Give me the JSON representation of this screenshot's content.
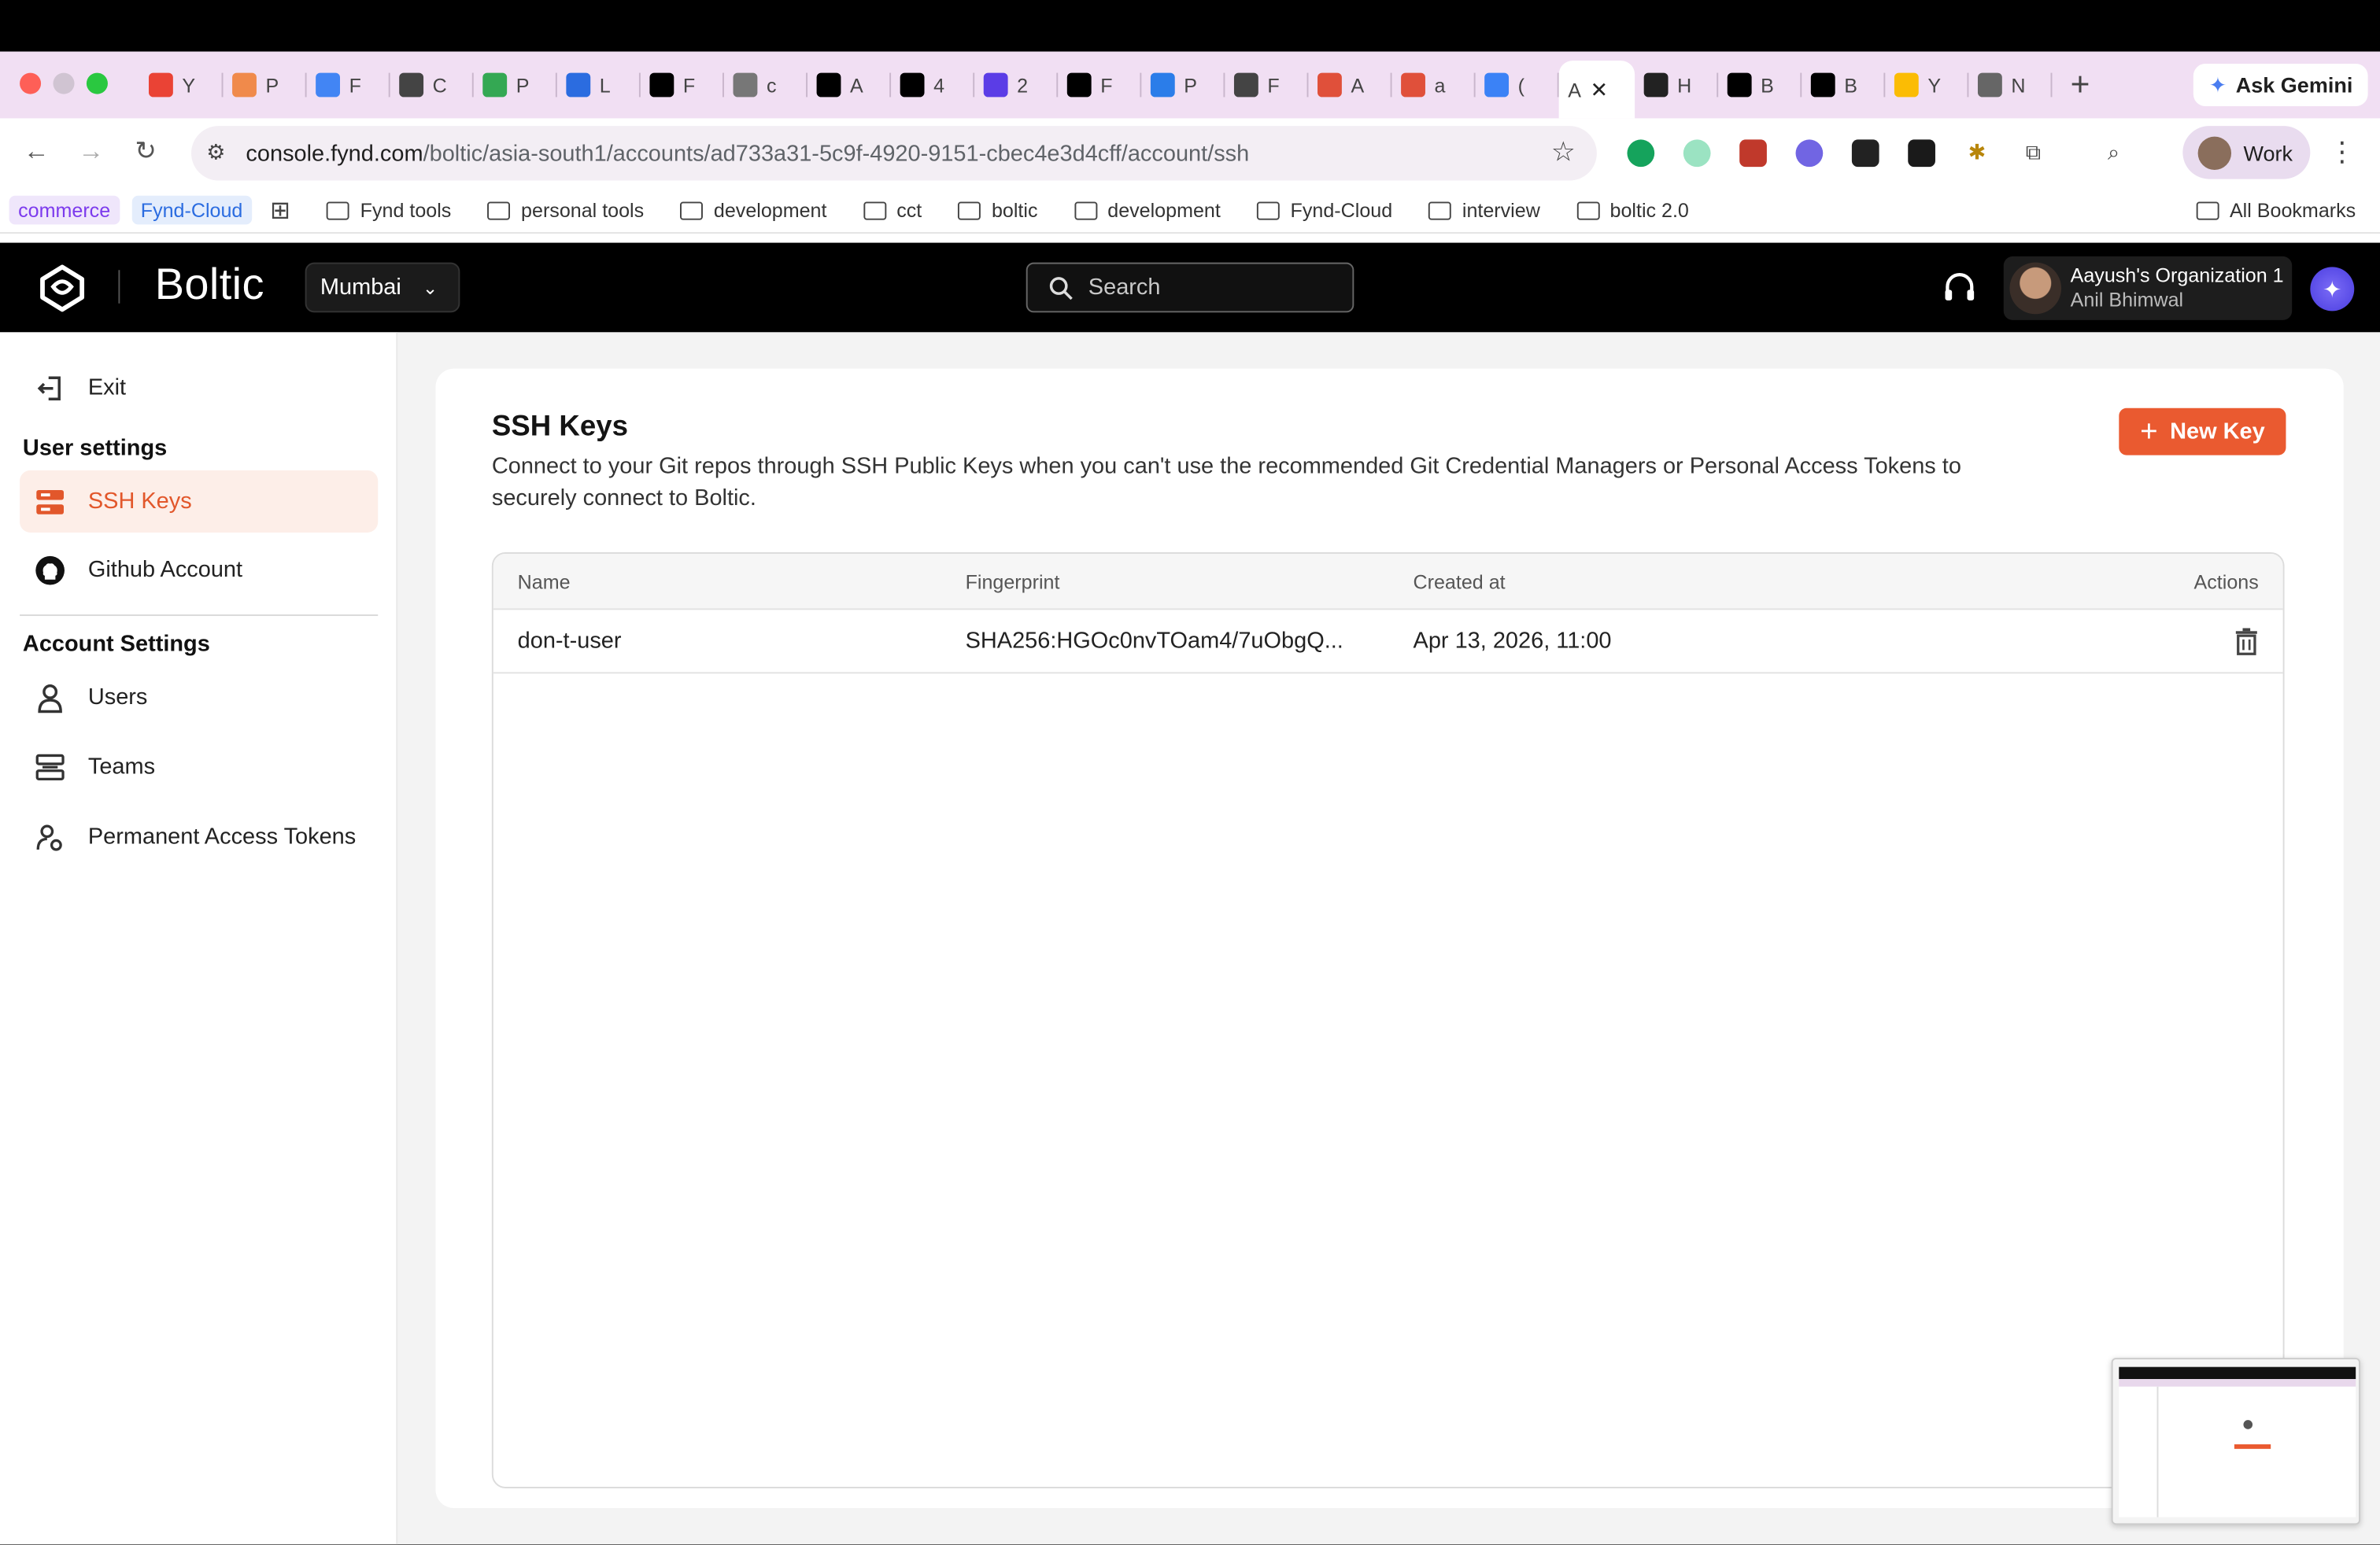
{
  "browser": {
    "tabs": [
      {
        "icon": "gmail-icon",
        "letter": "Y",
        "color": "#ea4335"
      },
      {
        "icon": "orange-circle-icon",
        "letter": "P",
        "color": "#f08a4b"
      },
      {
        "icon": "calendar-icon",
        "letter": "F",
        "color": "#4285f4"
      },
      {
        "icon": "openai-icon",
        "letter": "C",
        "color": "#444444"
      },
      {
        "icon": "sheets-icon",
        "letter": "P",
        "color": "#34a853"
      },
      {
        "icon": "triangle-icon",
        "letter": "L",
        "color": "#2b6ce0"
      },
      {
        "icon": "boltic-icon",
        "letter": "F",
        "color": "#000000"
      },
      {
        "icon": "globe-icon",
        "letter": "c",
        "color": "#777777"
      },
      {
        "icon": "boltic-icon",
        "letter": "A",
        "color": "#000000"
      },
      {
        "icon": "boltic-icon",
        "letter": "4",
        "color": "#000000"
      },
      {
        "icon": "purple-square-icon",
        "letter": "2",
        "color": "#5b3de6"
      },
      {
        "icon": "boltic-icon",
        "letter": "F",
        "color": "#000000"
      },
      {
        "icon": "azure-icon",
        "letter": "P",
        "color": "#2b7de9"
      },
      {
        "icon": "boltic-outline-icon",
        "letter": "F",
        "color": "#444444"
      },
      {
        "icon": "red-bolt-icon",
        "letter": "A",
        "color": "#e0503a"
      },
      {
        "icon": "red-bolt-icon",
        "letter": "a",
        "color": "#e0503a"
      },
      {
        "icon": "blue-doc-icon",
        "letter": "(",
        "color": "#3b82f6"
      },
      {
        "icon": "active-tab",
        "letter": "A",
        "color": "#ffffff"
      },
      {
        "icon": "openai-icon",
        "letter": "H",
        "color": "#222222"
      },
      {
        "icon": "boltic-icon",
        "letter": "B",
        "color": "#000000"
      },
      {
        "icon": "boltic-icon",
        "letter": "B",
        "color": "#000000"
      },
      {
        "icon": "gcloud-icon",
        "letter": "Y",
        "color": "#fbbc04"
      },
      {
        "icon": "chrome-icon",
        "letter": "N",
        "color": "#666666"
      }
    ],
    "ask_gemini": "Ask Gemini",
    "url_host": "console.fynd.com",
    "url_path": "/boltic/asia-south1/accounts/ad733a31-5c9f-4920-9151-cbec4e3d4cff/account/ssh",
    "profile_label": "Work",
    "bookmarks": {
      "commerce": "commerce",
      "fynd_cloud": "Fynd-Cloud",
      "folders": [
        "Fynd tools",
        "personal tools",
        "development",
        "cct",
        "boltic",
        "development",
        "Fynd-Cloud",
        "interview",
        "boltic 2.0"
      ],
      "all": "All Bookmarks"
    }
  },
  "header": {
    "brand": "Boltic",
    "region": "Mumbai",
    "search_placeholder": "Search",
    "org_name": "Aayush's Organization 1",
    "user_name": "Anil Bhimwal"
  },
  "sidebar": {
    "exit": "Exit",
    "user_settings_heading": "User settings",
    "ssh_keys": "SSH Keys",
    "github_account": "Github Account",
    "account_settings_heading": "Account Settings",
    "users": "Users",
    "teams": "Teams",
    "permanent_tokens": "Permanent Access Tokens"
  },
  "main": {
    "title": "SSH Keys",
    "description": "Connect to your Git repos through SSH Public Keys when you can't use the recommended Git Credential Managers or Personal Access Tokens to securely connect to Boltic.",
    "new_key_label": "New Key",
    "columns": {
      "name": "Name",
      "fingerprint": "Fingerprint",
      "created_at": "Created at",
      "actions": "Actions"
    },
    "rows": [
      {
        "name": "don-t-user",
        "fingerprint": "SHA256:HGOc0nvTOam4/7uObgQ...",
        "created_at": "Apr 13, 2026, 11:00"
      }
    ]
  },
  "colors": {
    "accent": "#ea5a30",
    "active_bg": "#fdeee8",
    "header_bg": "#000000"
  }
}
